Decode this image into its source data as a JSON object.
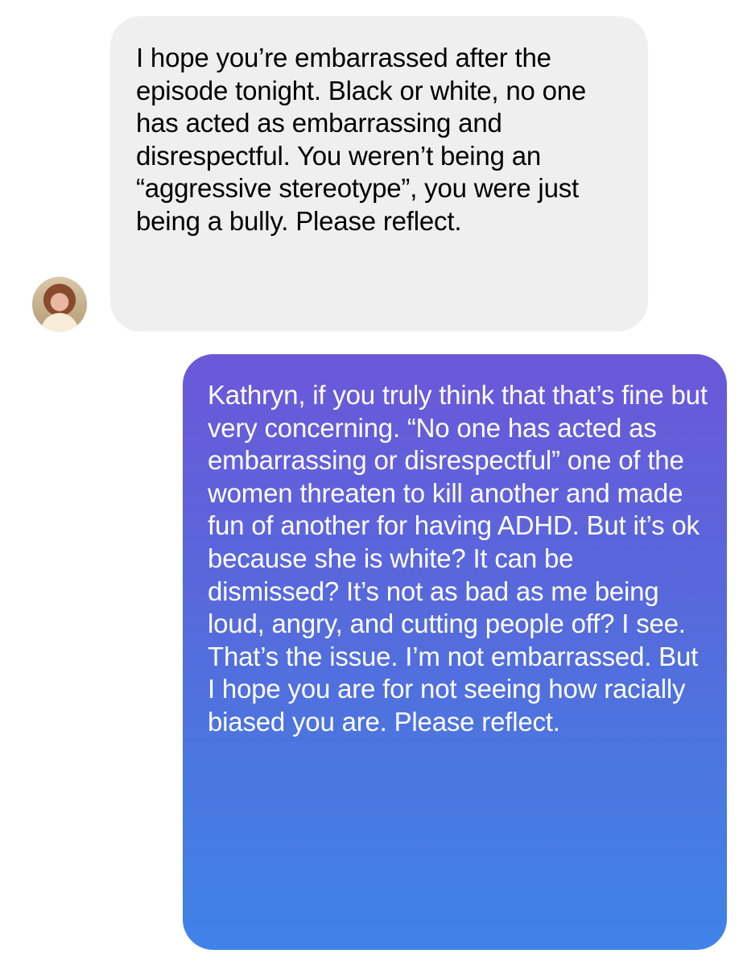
{
  "messages": [
    {
      "direction": "incoming",
      "text": "I hope you’re embarrassed after the episode tonight. Black or white, no one has acted as embarrassing and disrespectful. You weren’t being an “aggressive stereotype”, you were just being a bully. Please reflect.",
      "bubble_color": "#efefef",
      "text_color": "#000000",
      "avatar_icon": "profile-photo-icon"
    },
    {
      "direction": "outgoing",
      "text": "Kathryn, if you truly think that that’s fine but very concerning. “No one has acted as embarrassing or disrespectful” one of the women threaten to kill another and made fun of another for having ADHD. But it’s ok because she is white? It can be dismissed? It’s not as bad as me being loud, angry, and cutting people off? I see. That’s the issue. I’m not embarrassed. But I hope you are for not seeing how racially biased you are. Please reflect.",
      "bubble_gradient": [
        "#6b58d9",
        "#3f83e8"
      ],
      "text_color": "#ffffff"
    }
  ]
}
